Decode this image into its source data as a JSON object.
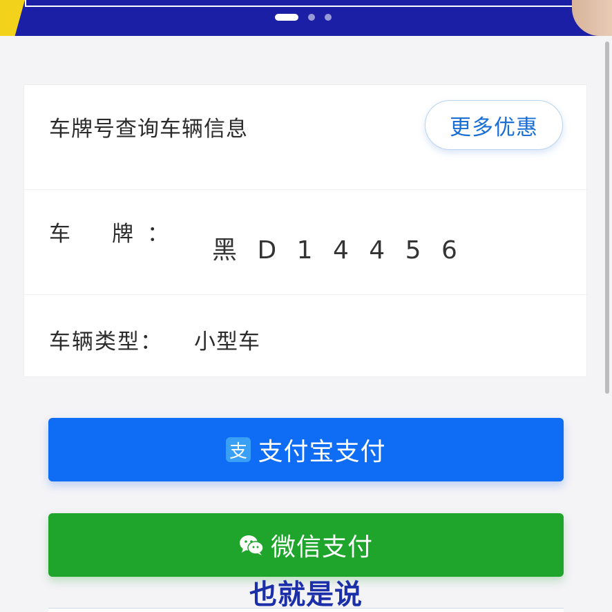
{
  "card": {
    "title": "车牌号查询车辆信息",
    "more_button": "更多优惠",
    "plate_label": "车牌",
    "plate_colon": "：",
    "plate_value": "黑 D 1 4 4 5 6",
    "type_label": "车辆类型：",
    "type_value": "小型车"
  },
  "payment": {
    "alipay_icon_glyph": "支",
    "alipay_label": "支付宝支付",
    "wechat_label": "微信支付"
  },
  "subtitle": "也就是说",
  "colors": {
    "alipay": "#0f6cf5",
    "wechat": "#1fa42c",
    "accent": "#1a6fd6"
  },
  "icons": [
    "alipay-icon",
    "wechat-icon"
  ]
}
